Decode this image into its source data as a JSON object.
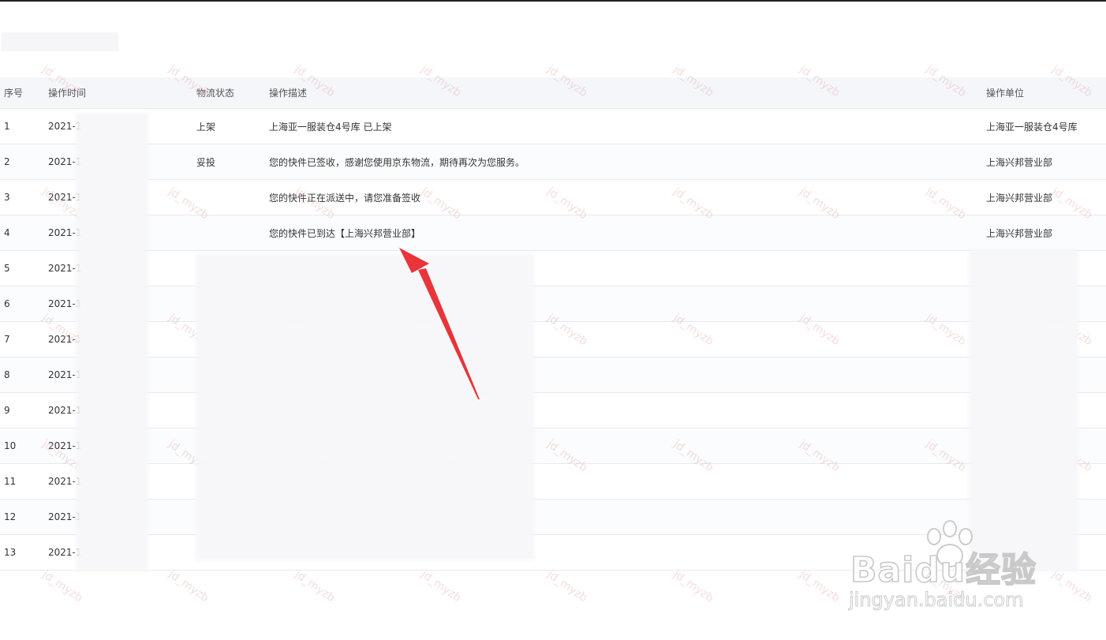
{
  "table": {
    "headers": {
      "index": "序号",
      "time": "操作时间",
      "status": "物流状态",
      "description": "操作描述",
      "unit": "操作单位"
    },
    "rows": [
      {
        "index": "1",
        "time": "2021-1",
        "status": "上架",
        "description": "上海亚一服装仓4号库 已上架",
        "unit": "上海亚一服装仓4号库"
      },
      {
        "index": "2",
        "time": "2021-1",
        "status": "妥投",
        "description": "您的快件已签收，感谢您使用京东物流，期待再次为您服务。",
        "unit": "上海兴邦营业部"
      },
      {
        "index": "3",
        "time": "2021-1",
        "status": "",
        "description": "您的快件正在派送中，请您准备签收",
        "unit": "上海兴邦营业部"
      },
      {
        "index": "4",
        "time": "2021-1",
        "status": "",
        "description": "您的快件已到达【上海兴邦营业部】",
        "unit": "上海兴邦营业部"
      },
      {
        "index": "5",
        "time": "2021-1",
        "status": "",
        "description": "",
        "unit": ""
      },
      {
        "index": "6",
        "time": "2021-1",
        "status": "",
        "description": "",
        "unit": ""
      },
      {
        "index": "7",
        "time": "2021-1",
        "status": "",
        "description": "",
        "unit": ""
      },
      {
        "index": "8",
        "time": "2021-1",
        "status": "",
        "description": "",
        "unit": ""
      },
      {
        "index": "9",
        "time": "2021-1",
        "status": "",
        "description": "",
        "unit": ""
      },
      {
        "index": "10",
        "time": "2021-1",
        "status": "",
        "description": "",
        "unit": ""
      },
      {
        "index": "11",
        "time": "2021-1",
        "status": "",
        "description": "",
        "unit": ""
      },
      {
        "index": "12",
        "time": "2021-1",
        "status": "",
        "description": "",
        "unit": ""
      },
      {
        "index": "13",
        "time": "2021-1",
        "status": "",
        "description": "",
        "unit": ""
      }
    ]
  },
  "watermark": {
    "text": "jd_myzb"
  },
  "logo": {
    "brand": "Baidu经验",
    "url_text": "jingyan.baidu.com"
  },
  "colors": {
    "arrow": "#e8343a",
    "header_bg": "#f4f6fa",
    "border": "#e8eaef"
  }
}
